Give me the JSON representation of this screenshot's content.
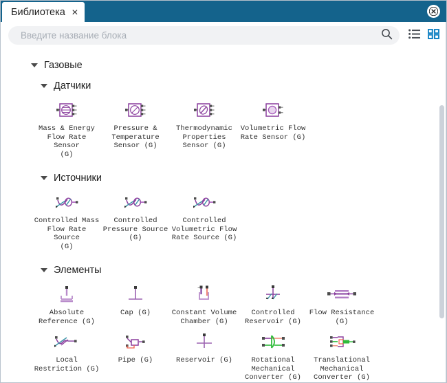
{
  "window": {
    "tab_label": "Библиотека",
    "tab_close_glyph": "✕",
    "close_icon_name": "close-icon"
  },
  "search": {
    "placeholder": "Введите название блока",
    "value": "",
    "search_icon": "search-icon",
    "list_view_icon": "list-view-icon",
    "grid_view_icon": "grid-view-icon",
    "active_view": "grid"
  },
  "colors": {
    "titlebar": "#14638c",
    "accent_blue": "#1583c4",
    "icon_purple": "#8b3f9e",
    "icon_purple_light": "#c39ad0",
    "icon_teal": "#3f96a8",
    "icon_green": "#2fbb3b",
    "icon_salmon": "#f08a7a",
    "pin_gray": "#4d4d4d",
    "scrollbar": "#ccd2da"
  },
  "tree": {
    "root": {
      "label": "Газовые",
      "expanded": true
    },
    "sections": [
      {
        "label": "Датчики",
        "expanded": true,
        "blocks": [
          {
            "label": "Mass & Energy\nFlow Rate Sensor\n(G)",
            "icon": "mass-energy-flow-rate-sensor-icon"
          },
          {
            "label": "Pressure &\nTemperature\nSensor (G)",
            "icon": "pressure-temperature-sensor-icon"
          },
          {
            "label": "Thermodynamic\nProperties\nSensor (G)",
            "icon": "thermodynamic-properties-sensor-icon"
          },
          {
            "label": "Volumetric Flow\nRate Sensor (G)",
            "icon": "volumetric-flow-rate-sensor-icon"
          }
        ]
      },
      {
        "label": "Источники",
        "expanded": true,
        "blocks": [
          {
            "label": "Controlled Mass\nFlow Rate Source\n(G)",
            "icon": "controlled-mass-flow-rate-source-icon"
          },
          {
            "label": "Controlled\nPressure Source\n(G)",
            "icon": "controlled-pressure-source-icon"
          },
          {
            "label": "Controlled\nVolumetric Flow\nRate Source (G)",
            "icon": "controlled-volumetric-flow-rate-source-icon"
          }
        ]
      },
      {
        "label": "Элементы",
        "expanded": true,
        "blocks": [
          {
            "label": "Absolute\nReference (G)",
            "icon": "absolute-reference-icon"
          },
          {
            "label": "Cap (G)",
            "icon": "cap-icon"
          },
          {
            "label": "Constant Volume\nChamber (G)",
            "icon": "constant-volume-chamber-icon"
          },
          {
            "label": "Controlled\nReservoir (G)",
            "icon": "controlled-reservoir-icon"
          },
          {
            "label": "Flow Resistance\n(G)",
            "icon": "flow-resistance-icon"
          },
          {
            "label": "Local\nRestriction (G)",
            "icon": "local-restriction-icon"
          },
          {
            "label": "Pipe (G)",
            "icon": "pipe-icon"
          },
          {
            "label": "Reservoir (G)",
            "icon": "reservoir-icon"
          },
          {
            "label": "Rotational\nMechanical\nConverter (G)",
            "icon": "rotational-mechanical-converter-icon"
          },
          {
            "label": "Translational\nMechanical\nConverter (G)",
            "icon": "translational-mechanical-converter-icon"
          }
        ]
      }
    ]
  }
}
